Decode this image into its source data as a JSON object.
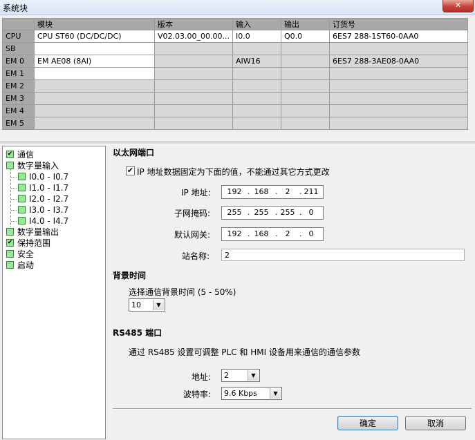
{
  "window": {
    "title": "系统块",
    "close_glyph": "✕"
  },
  "grid": {
    "headers": [
      "",
      "模块",
      "版本",
      "输入",
      "输出",
      "订货号"
    ],
    "rows": [
      {
        "slot": "CPU",
        "module": "CPU ST60 (DC/DC/DC)",
        "version": "V02.03.00_00.00...",
        "input": "I0.0",
        "output": "Q0.0",
        "order": "6ES7 288-1ST60-0AA0"
      },
      {
        "slot": "SB",
        "module": "",
        "version": "",
        "input": "",
        "output": "",
        "order": ""
      },
      {
        "slot": "EM 0",
        "module": "EM AE08 (8AI)",
        "version": "",
        "input": "AIW16",
        "output": "",
        "order": "6ES7 288-3AE08-0AA0"
      },
      {
        "slot": "EM 1",
        "module": "",
        "version": "",
        "input": "",
        "output": "",
        "order": ""
      },
      {
        "slot": "EM 2",
        "module": "",
        "version": "",
        "input": "",
        "output": "",
        "order": ""
      },
      {
        "slot": "EM 3",
        "module": "",
        "version": "",
        "input": "",
        "output": "",
        "order": ""
      },
      {
        "slot": "EM 4",
        "module": "",
        "version": "",
        "input": "",
        "output": "",
        "order": ""
      },
      {
        "slot": "EM 5",
        "module": "",
        "version": "",
        "input": "",
        "output": "",
        "order": ""
      }
    ]
  },
  "tree": {
    "items": [
      {
        "label": "通信",
        "checked": true
      },
      {
        "label": "数字量输入",
        "checked": false
      },
      {
        "label": "I0.0 - I0.7",
        "checked": false
      },
      {
        "label": "I1.0 - I1.7",
        "checked": false
      },
      {
        "label": "I2.0 - I2.7",
        "checked": false
      },
      {
        "label": "I3.0 - I3.7",
        "checked": false
      },
      {
        "label": "I4.0 - I4.7",
        "checked": false
      },
      {
        "label": "数字量输出",
        "checked": false
      },
      {
        "label": "保持范围",
        "checked": true
      },
      {
        "label": "安全",
        "checked": false
      },
      {
        "label": "启动",
        "checked": false
      }
    ]
  },
  "ethernet": {
    "title": "以太网端口",
    "fixed_ip_label": "IP 地址数据固定为下面的值，不能通过其它方式更改",
    "fixed_ip_checked": "✔",
    "ip_label": "IP 地址:",
    "ip": [
      "192",
      "168",
      "2",
      "211"
    ],
    "mask_label": "子网掩码:",
    "mask": [
      "255",
      "255",
      "255",
      "0"
    ],
    "gateway_label": "默认网关:",
    "gateway": [
      "192",
      "168",
      "2",
      "0"
    ],
    "station_label": "站名称:",
    "station_value": "2",
    "dot": "."
  },
  "background_time": {
    "title": "背景时间",
    "desc": "选择通信背景时间 (5 - 50%)",
    "value": "10"
  },
  "rs485": {
    "title": "RS485 端口",
    "desc": "通过 RS485 设置可调整 PLC 和 HMI 设备用来通信的通信参数",
    "address_label": "地址:",
    "address_value": "2",
    "baud_label": "波特率:",
    "baud_value": "9.6 Kbps"
  },
  "buttons": {
    "ok": "确定",
    "cancel": "取消"
  },
  "icons": {
    "dropdown": "▼",
    "tree_node": "green-square-icon",
    "check": "✔"
  },
  "colors": {
    "grid_header": "#a8a8a8",
    "grid_cell_empty": "#d8d8d8",
    "tree_icon": "#9ee39e",
    "close_button": "#c7443a"
  }
}
